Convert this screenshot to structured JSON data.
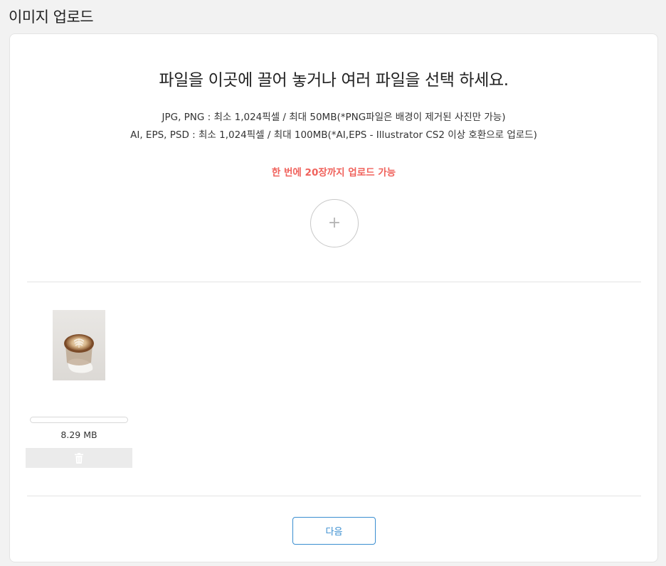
{
  "page": {
    "title": "이미지 업로드"
  },
  "upload": {
    "heading": "파일을 이곳에 끌어 놓거나 여러 파일을 선택 하세요.",
    "spec_line_1": "JPG, PNG : 최소 1,024픽셀 / 최대 50MB(*PNG파일은 배경이 제거된 사진만 가능)",
    "spec_line_2": "AI, EPS, PSD : 최소 1,024픽셀 / 최대 100MB(*AI,EPS - Illustrator CS2 이상 호환으로 업로드)",
    "limit_note": "한 번에 20장까지 업로드 가능",
    "add_symbol": "+",
    "add_icon": "plus-icon"
  },
  "files": [
    {
      "thumbnail": "latte-art-coffee-photo",
      "size": "8.29 MB",
      "progress": 0,
      "delete_icon": "trash-icon"
    }
  ],
  "footer": {
    "next_label": "다음"
  },
  "colors": {
    "accent_blue": "#3a8ed0",
    "limit_red": "#f0625c",
    "background": "#f2f2f2"
  }
}
